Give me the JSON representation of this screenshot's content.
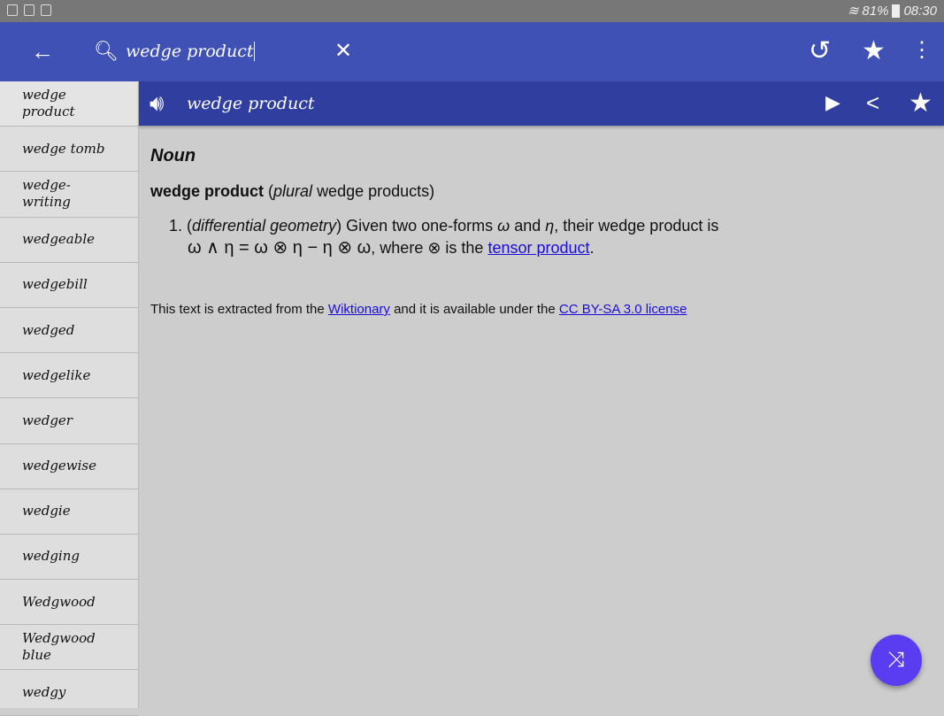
{
  "status_bar": {
    "battery": "81%",
    "time": "08:30"
  },
  "toolbar": {
    "search_value": "wedge product",
    "icons": [
      "back-arrow",
      "search",
      "clear",
      "history",
      "star",
      "more-vert"
    ]
  },
  "sidebar": {
    "items": [
      "wedge product",
      "wedge tomb",
      "wedge-writing",
      "wedgeable",
      "wedgebill",
      "wedged",
      "wedgelike",
      "wedger",
      "wedgewise",
      "wedgie",
      "wedging",
      "Wedgwood",
      "Wedgwood blue",
      "wedgy"
    ]
  },
  "entry_bar": {
    "title": "wedge product"
  },
  "entry": {
    "pos": "Noun",
    "headword": "wedge product",
    "plural_label": "plural",
    "plural_form": "wedge products",
    "definition": {
      "number": "1.",
      "context": "differential geometry",
      "text1": " Given two one-forms ",
      "omega": "ω",
      "and": " and ",
      "eta": "η",
      "text2": ", their wedge product is",
      "formula": "ω ∧ η = ω ⊗ η − η ⊗ ω",
      "where": ", where ⊗ is the ",
      "link": "tensor product",
      "end": "."
    },
    "footer": {
      "t1": "This text is extracted from the ",
      "link1": "Wiktionary",
      "t2": " and it is available under the ",
      "link2": "CC BY-SA 3.0 license"
    }
  },
  "colors": {
    "toolbar": "#3f51b5",
    "entry_bar": "#303f9f",
    "fab": "#5a3df0"
  }
}
